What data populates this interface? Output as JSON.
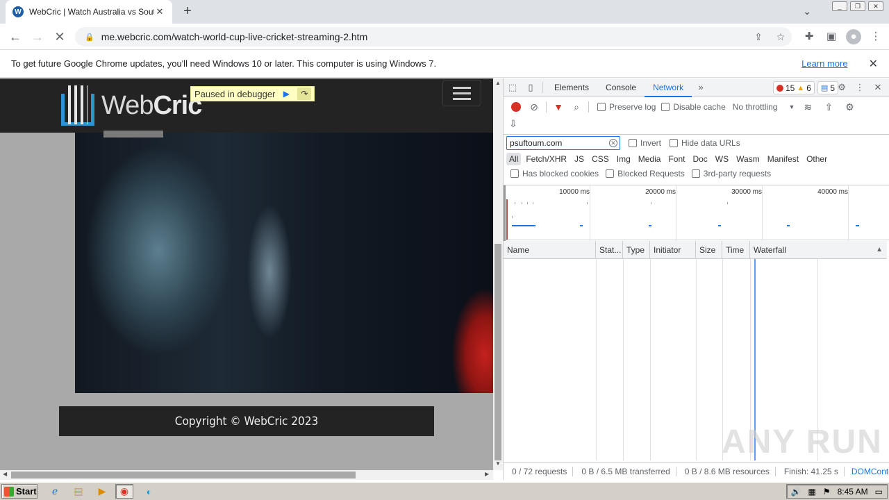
{
  "browser": {
    "tab": {
      "title": "WebCric | Watch Australia vs South",
      "favicon": "webcric-favicon"
    },
    "address_bar": {
      "url": "me.webcric.com/watch-world-cup-live-cricket-streaming-2.htm"
    }
  },
  "infobar": {
    "message": "To get future Google Chrome updates, you'll need Windows 10 or later. This computer is using Windows 7.",
    "link": "Learn more"
  },
  "page": {
    "logo_text_web": "Web",
    "logo_text_cric": "Cric",
    "debugger_banner": "Paused in debugger",
    "footer": "Copyright © WebCric 2023"
  },
  "devtools": {
    "tabs": [
      "Elements",
      "Console",
      "Network"
    ],
    "active_tab": "Network",
    "counts": {
      "errors": "15",
      "warnings": "6",
      "info": "5"
    },
    "toolbar": {
      "preserve_log": "Preserve log",
      "disable_cache": "Disable cache",
      "throttling": "No throttling"
    },
    "filter": {
      "value": "psuftoum.com",
      "invert": "Invert",
      "hide_data_urls": "Hide data URLs"
    },
    "types": [
      "All",
      "Fetch/XHR",
      "JS",
      "CSS",
      "Img",
      "Media",
      "Font",
      "Doc",
      "WS",
      "Wasm",
      "Manifest",
      "Other"
    ],
    "blocked": {
      "has_blocked_cookies": "Has blocked cookies",
      "blocked_requests": "Blocked Requests",
      "third_party": "3rd-party requests"
    },
    "overview_ticks": [
      "10000 ms",
      "20000 ms",
      "30000 ms",
      "40000 ms"
    ],
    "columns": {
      "name": "Name",
      "status": "Stat...",
      "type": "Type",
      "initiator": "Initiator",
      "size": "Size",
      "time": "Time",
      "waterfall": "Waterfall"
    },
    "status": {
      "requests": "0 / 72 requests",
      "transferred": "0 B / 6.5 MB transferred",
      "resources": "0 B / 8.6 MB resources",
      "finish": "Finish: 41.25 s",
      "domcontent": "DOMConter"
    }
  },
  "watermark": "ANY RUN",
  "taskbar": {
    "start": "Start",
    "clock": "8:45 AM"
  }
}
